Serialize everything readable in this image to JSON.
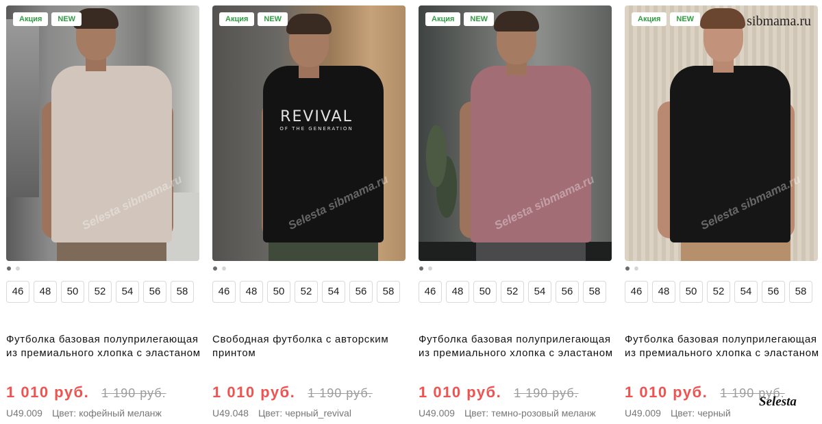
{
  "products": [
    {
      "badges": [
        "Акция",
        "NEW"
      ],
      "title": "Футболка базовая полуприлегающая из премиального хлопка с эластаном",
      "price": "1 010 руб.",
      "old_price": "1 190 руб.",
      "sku": "U49.009",
      "color_label": "Цвет:",
      "color": "кофейный меланж",
      "sizes": [
        "46",
        "48",
        "50",
        "52",
        "54",
        "56",
        "58"
      ],
      "shirt_color": "#d2c6bc",
      "photo_watermark": "Selesta sibmama.ru"
    },
    {
      "badges": [
        "Акция",
        "NEW"
      ],
      "title": "Свободная футболка с авторским принтом",
      "price": "1 010 руб.",
      "old_price": "1 190 руб.",
      "sku": "U49.048",
      "color_label": "Цвет:",
      "color": "черный_revival",
      "sizes": [
        "46",
        "48",
        "50",
        "52",
        "54",
        "56",
        "58"
      ],
      "print_main": "REVIVAL",
      "print_sub": "OF THE GENERATION",
      "shirt_color": "#131313",
      "photo_watermark": "Selesta sibmama.ru"
    },
    {
      "badges": [
        "Акция",
        "NEW"
      ],
      "title": "Футболка базовая полуприлегающая из премиального хлопка с эластаном",
      "price": "1 010 руб.",
      "old_price": "1 190 руб.",
      "sku": "U49.009",
      "color_label": "Цвет:",
      "color": "темно-розовый меланж",
      "sizes": [
        "46",
        "48",
        "50",
        "52",
        "54",
        "56",
        "58"
      ],
      "shirt_color": "#a36d76",
      "photo_watermark": "Selesta sibmama.ru"
    },
    {
      "badges": [
        "Акция",
        "NEW"
      ],
      "title": "Футболка базовая полуприлегающая из премиального хлопка с эластаном",
      "price": "1 010 руб.",
      "old_price": "1 190 руб.",
      "sku": "U49.009",
      "color_label": "Цвет:",
      "color": "черный",
      "sizes": [
        "46",
        "48",
        "50",
        "52",
        "54",
        "56",
        "58"
      ],
      "shirt_color": "#161616",
      "photo_watermark": "Selesta sibmama.ru"
    }
  ],
  "site_watermark": "sibmama.ru",
  "brand_watermark": "Selesta",
  "colors": {
    "badge_text": "#2e9c40",
    "price": "#ef5350",
    "old_price": "#9c9c9c"
  }
}
